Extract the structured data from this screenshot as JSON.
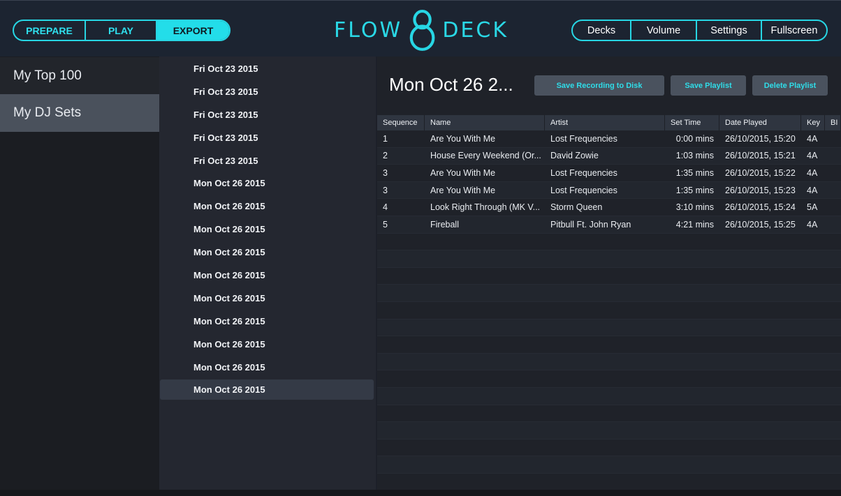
{
  "topbar": {
    "mode_tabs": [
      {
        "label": "PREPARE",
        "active": false
      },
      {
        "label": "PLAY",
        "active": false
      },
      {
        "label": "EXPORT",
        "active": true
      }
    ],
    "logo": {
      "left": "FLOW",
      "middle": "8",
      "right": "DECK"
    },
    "right_tabs": [
      {
        "label": "Decks"
      },
      {
        "label": "Volume"
      },
      {
        "label": "Settings"
      },
      {
        "label": "Fullscreen"
      }
    ]
  },
  "sidebar": {
    "items": [
      {
        "label": "My Top 100",
        "active": false
      },
      {
        "label": "My DJ Sets",
        "active": true
      }
    ]
  },
  "datelist": {
    "items": [
      "Fri Oct 23 2015",
      "Fri Oct 23 2015",
      "Fri Oct 23 2015",
      "Fri Oct 23 2015",
      "Fri Oct 23 2015",
      "Mon Oct 26 2015",
      "Mon Oct 26 2015",
      "Mon Oct 26 2015",
      "Mon Oct 26 2015",
      "Mon Oct 26 2015",
      "Mon Oct 26 2015",
      "Mon Oct 26 2015",
      "Mon Oct 26 2015",
      "Mon Oct 26 2015",
      "Mon Oct 26 2015"
    ],
    "selected_index": 14
  },
  "main": {
    "title": "Mon Oct 26 2...",
    "buttons": {
      "save_recording": "Save Recording to Disk",
      "save_playlist": "Save Playlist",
      "delete_playlist": "Delete Playlist"
    },
    "table": {
      "headers": [
        "Sequence",
        "Name",
        "Artist",
        "Set Time",
        "Date Played",
        "Key",
        "BPM"
      ],
      "header_bpm_visible": "BI",
      "rows": [
        {
          "seq": "1",
          "name": "Are You With Me",
          "artist": "Lost Frequencies",
          "set_time": "0:00 mins",
          "date": "26/10/2015, 15:20",
          "key": "4A"
        },
        {
          "seq": "2",
          "name": "House Every Weekend (Or...",
          "artist": "David Zowie",
          "set_time": "1:03 mins",
          "date": "26/10/2015, 15:21",
          "key": "4A"
        },
        {
          "seq": "3",
          "name": "Are You With Me",
          "artist": "Lost Frequencies",
          "set_time": "1:35 mins",
          "date": "26/10/2015, 15:22",
          "key": "4A"
        },
        {
          "seq": "3",
          "name": "Are You With Me",
          "artist": "Lost Frequencies",
          "set_time": "1:35 mins",
          "date": "26/10/2015, 15:23",
          "key": "4A"
        },
        {
          "seq": "4",
          "name": "Look Right Through (MK V...",
          "artist": "Storm Queen",
          "set_time": "3:10 mins",
          "date": "26/10/2015, 15:24",
          "key": "5A"
        },
        {
          "seq": "5",
          "name": "Fireball",
          "artist": "Pitbull Ft. John Ryan",
          "set_time": "4:21 mins",
          "date": "26/10/2015, 15:25",
          "key": "4A"
        }
      ]
    }
  },
  "colors": {
    "accent": "#27d6e4",
    "background": "#1d2029",
    "topbar": "#1c2431",
    "sidebar_active": "#4a515c",
    "button": "#4a525e"
  }
}
